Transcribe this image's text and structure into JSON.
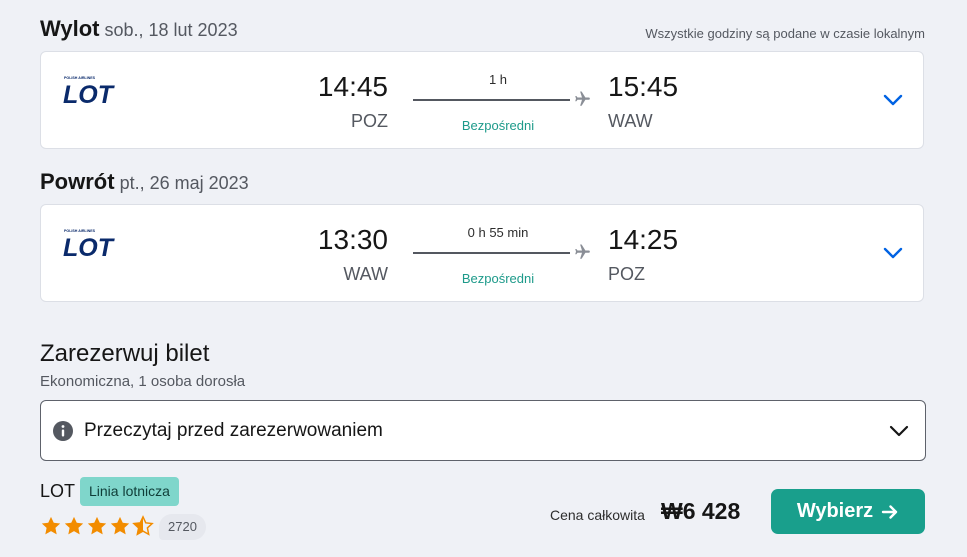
{
  "outbound": {
    "title": "Wylot",
    "date": "sob., 18 lut 2023",
    "tz_note": "Wszystkie godziny są podane w czasie lokalnym",
    "airline_logo": "LOT",
    "airline_logo_sub": "POLISH AIRLINES",
    "dep_time": "14:45",
    "dep_code": "POZ",
    "duration": "1 h",
    "stops": "Bezpośredni",
    "arr_time": "15:45",
    "arr_code": "WAW"
  },
  "inbound": {
    "title": "Powrót",
    "date": "pt., 26 maj 2023",
    "airline_logo": "LOT",
    "airline_logo_sub": "POLISH AIRLINES",
    "dep_time": "13:30",
    "dep_code": "WAW",
    "duration": "0 h 55 min",
    "stops": "Bezpośredni",
    "arr_time": "14:25",
    "arr_code": "POZ"
  },
  "booking": {
    "title": "Zarezerwuj bilet",
    "subtitle": "Ekonomiczna, 1 osoba dorosła",
    "info_label": "Przeczytaj przed zarezerwowaniem",
    "provider": "LOT",
    "provider_badge": "Linia lotnicza",
    "rating_stars": 4.5,
    "review_count": "2720",
    "price_label": "Cena całkowita",
    "price_value": "₩6 428",
    "select_label": "Wybierz"
  },
  "colors": {
    "accent": "#199f8c",
    "chevron": "#0062e3",
    "star": "#f28c00",
    "logo": "#0a2a6b",
    "direct": "#1d9a8a"
  },
  "icons": {
    "plane": "plane-icon",
    "expand": "chevron-down-icon",
    "info": "info-icon",
    "star": "star-icon",
    "arrow": "arrow-right-icon"
  }
}
